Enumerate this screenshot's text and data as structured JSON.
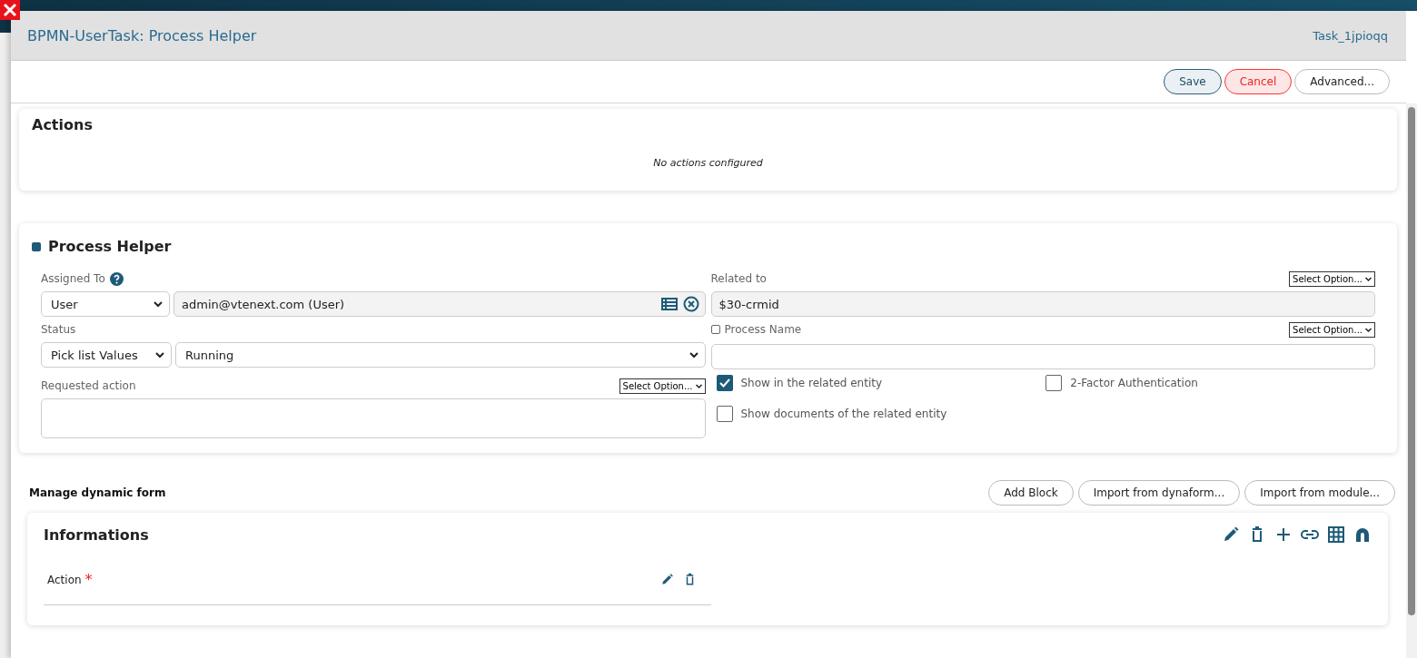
{
  "modal": {
    "title": "BPMN-UserTask: Process Helper",
    "task_id": "Task_1jpioqq",
    "buttons": [
      {
        "label": "Save",
        "kind": "primary"
      },
      {
        "label": "Cancel",
        "kind": "danger"
      },
      {
        "label": "Advanced...",
        "kind": "default"
      }
    ]
  },
  "actions_panel": {
    "title": "Actions",
    "empty_text": "No actions configured"
  },
  "task_panel": {
    "enabled": true,
    "title": "Process Helper",
    "assigned_to": {
      "label": "Assigned To",
      "type": "User",
      "value": "admin@vtenext.com (User)"
    },
    "status": {
      "label": "Status",
      "source": "Pick list Values",
      "value": "Running"
    },
    "requested_action": {
      "label": "Requested action",
      "option": "Select Option..."
    },
    "related_to": {
      "label": "Related to",
      "option": "Select Option...",
      "value": "$30-crmid"
    },
    "process_name": {
      "label": "Process Name",
      "checked": false,
      "option": "Select Option..."
    },
    "options": [
      {
        "label": "Show in the related entity",
        "checked": true
      },
      {
        "label": "2-Factor Authentication",
        "checked": false
      },
      {
        "label": "Show documents of the related entity",
        "checked": false
      }
    ]
  },
  "dynamic_form": {
    "title": "Manage dynamic form",
    "buttons": [
      "Add Block",
      "Import from dynaform...",
      "Import from module..."
    ],
    "blocks": [
      {
        "title": "Informations",
        "fields": [
          {
            "label": "Action",
            "required_mark": "*"
          }
        ]
      }
    ]
  }
}
